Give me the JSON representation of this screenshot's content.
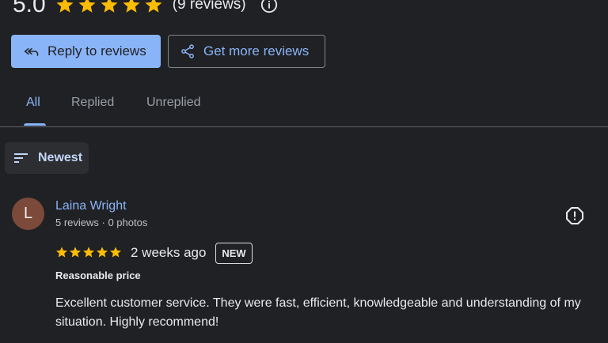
{
  "summary": {
    "rating": "5.0",
    "stars": 5,
    "review_count": "(9 reviews)"
  },
  "actions": {
    "reply_label": "Reply to reviews",
    "get_more_label": "Get more reviews"
  },
  "tabs": [
    {
      "label": "All",
      "active": true
    },
    {
      "label": "Replied",
      "active": false
    },
    {
      "label": "Unreplied",
      "active": false
    }
  ],
  "sort": {
    "label": "Newest"
  },
  "reviews": [
    {
      "avatar_letter": "L",
      "name": "Laina Wright",
      "meta": "5 reviews · 0 photos",
      "rating": 5,
      "time": "2 weeks ago",
      "badge": "NEW",
      "attribute": "Reasonable price",
      "text": "Excellent customer service. They were fast, efficient, knowledgeable and understanding of my situation. Highly recommend!"
    }
  ],
  "colors": {
    "background": "#202124",
    "accent": "#8ab4f8",
    "star": "#fbbc04",
    "avatar": "#7b4a3a"
  },
  "icons": [
    "star-icon",
    "info-icon",
    "reply-icon",
    "share-icon",
    "sort-icon",
    "flag-icon"
  ]
}
